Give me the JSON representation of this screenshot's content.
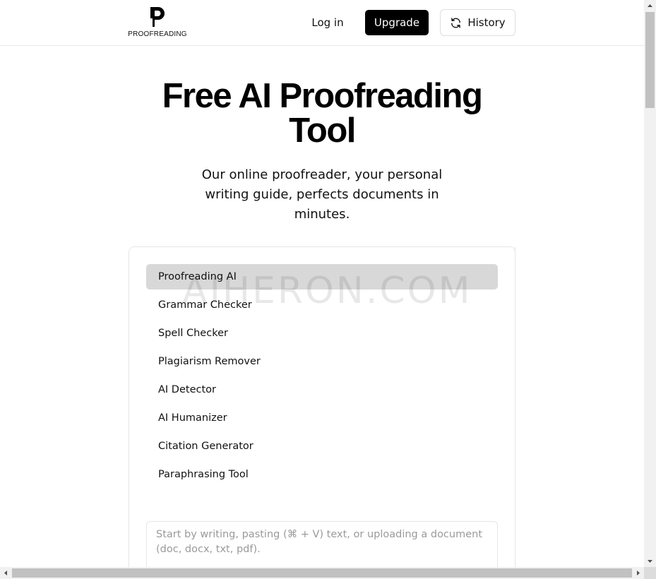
{
  "header": {
    "logo_text": "PROOFREADING",
    "login_label": "Log in",
    "upgrade_label": "Upgrade",
    "history_label": "History"
  },
  "hero": {
    "title": "Free AI Proofreading Tool",
    "subtitle": "Our online proofreader, your personal writing guide, perfects documents in minutes."
  },
  "menu": {
    "items": [
      {
        "label": "Proofreading AI",
        "active": true
      },
      {
        "label": "Grammar Checker"
      },
      {
        "label": "Spell Checker"
      },
      {
        "label": "Plagiarism Remover"
      },
      {
        "label": "AI Detector"
      },
      {
        "label": "AI Humanizer"
      },
      {
        "label": "Citation Generator"
      },
      {
        "label": "Paraphrasing Tool"
      }
    ]
  },
  "editor": {
    "value": "",
    "placeholder": "Start by writing, pasting (⌘ + V) text, or uploading a document (doc, docx, txt, pdf)."
  },
  "watermark": "AIHERON.COM",
  "colors": {
    "primary": "#000000",
    "active_item_bg": "#d8d8d8",
    "border": "#e6e6e6",
    "placeholder": "#9a9a9a"
  }
}
